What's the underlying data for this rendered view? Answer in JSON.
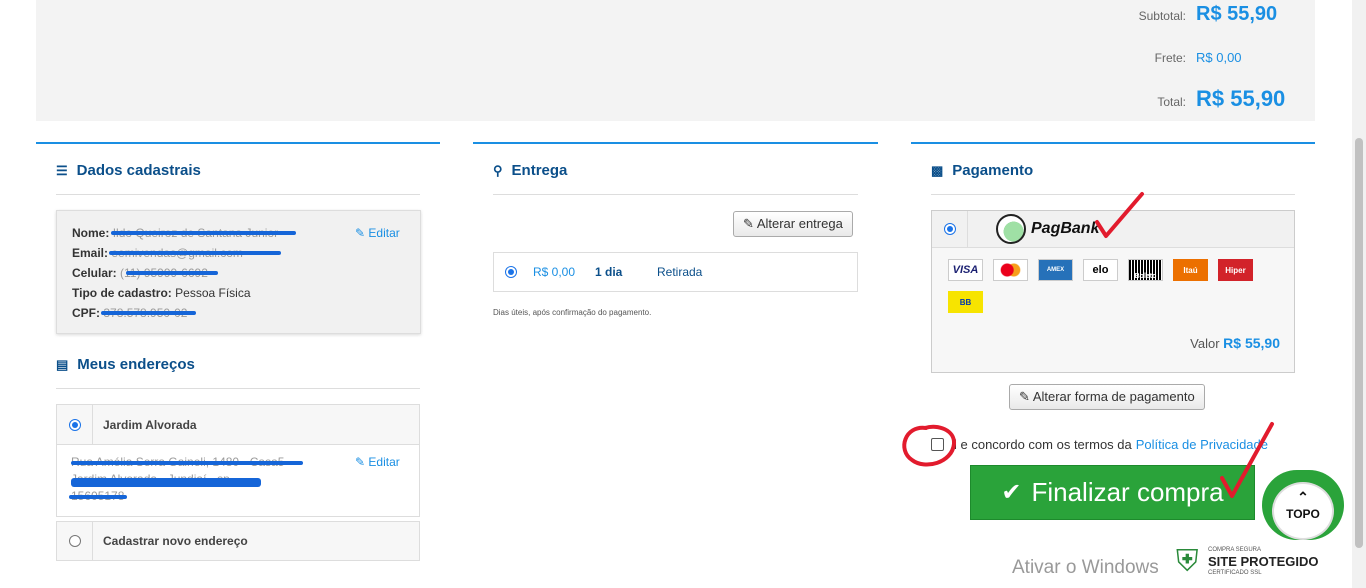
{
  "totals": {
    "subtotal_label": "Subtotal:",
    "subtotal_value": "R$ 55,90",
    "frete_label": "Frete:",
    "frete_value": "R$ 0,00",
    "total_label": "Total:",
    "total_value": "R$ 55,90"
  },
  "dados": {
    "title": "Dados cadastrais",
    "nome_label": "Nome:",
    "nome_value": "Ildo Queiroz de Santana Junior",
    "email_label": "Email:",
    "email_value": "eemivendas@gmail.com",
    "celular_label": "Celular:",
    "celular_value": "(11) 95999-6692",
    "tipo_label": "Tipo de cadastro:",
    "tipo_value": "Pessoa Física",
    "cpf_label": "CPF:",
    "cpf_value": "378.578.950-02",
    "edit_label": "Editar"
  },
  "enderecos": {
    "title": "Meus endereços",
    "address1_name": "Jardim Alvorada",
    "address1_line1": "Rua Amélia Serra Gaineli, 1480 - Casa5",
    "address1_line2": "Jardim Alvorada - Jundiaí - sp",
    "address1_line3": "15605178",
    "edit_label": "Editar",
    "new_address_label": "Cadastrar novo endereço"
  },
  "entrega": {
    "title": "Entrega",
    "alterar_label": "Alterar entrega",
    "price": "R$ 0,00",
    "days": "1 dia",
    "method": "Retirada",
    "note": "Dias úteis, após confirmação do pagamento."
  },
  "pagamento": {
    "title": "Pagamento",
    "provider": "PagBank",
    "cards": [
      "VISA",
      "MC",
      "AMEX",
      "elo",
      "Boleto",
      "Itaú",
      "Hiper",
      "BB"
    ],
    "valor_label": "Valor",
    "valor_value": "R$ 55,90",
    "alterar_label": "Alterar forma de pagamento",
    "terms_text": "i e concordo com os termos da",
    "terms_link": "Política de Privacidade",
    "finalizar_label": "Finalizar compra"
  },
  "topo_label": "TOPO",
  "windows_text": "Ativar o Windows",
  "seal": {
    "top": "COMPRA SEGURA",
    "main": "SITE PROTEGIDO",
    "bottom": "CERTIFICADO SSL"
  },
  "colors": {
    "accent": "#1a8fe3",
    "title": "#0b4f8a",
    "finalizar": "#2aa33a",
    "annotation_red": "#e21b2d"
  }
}
